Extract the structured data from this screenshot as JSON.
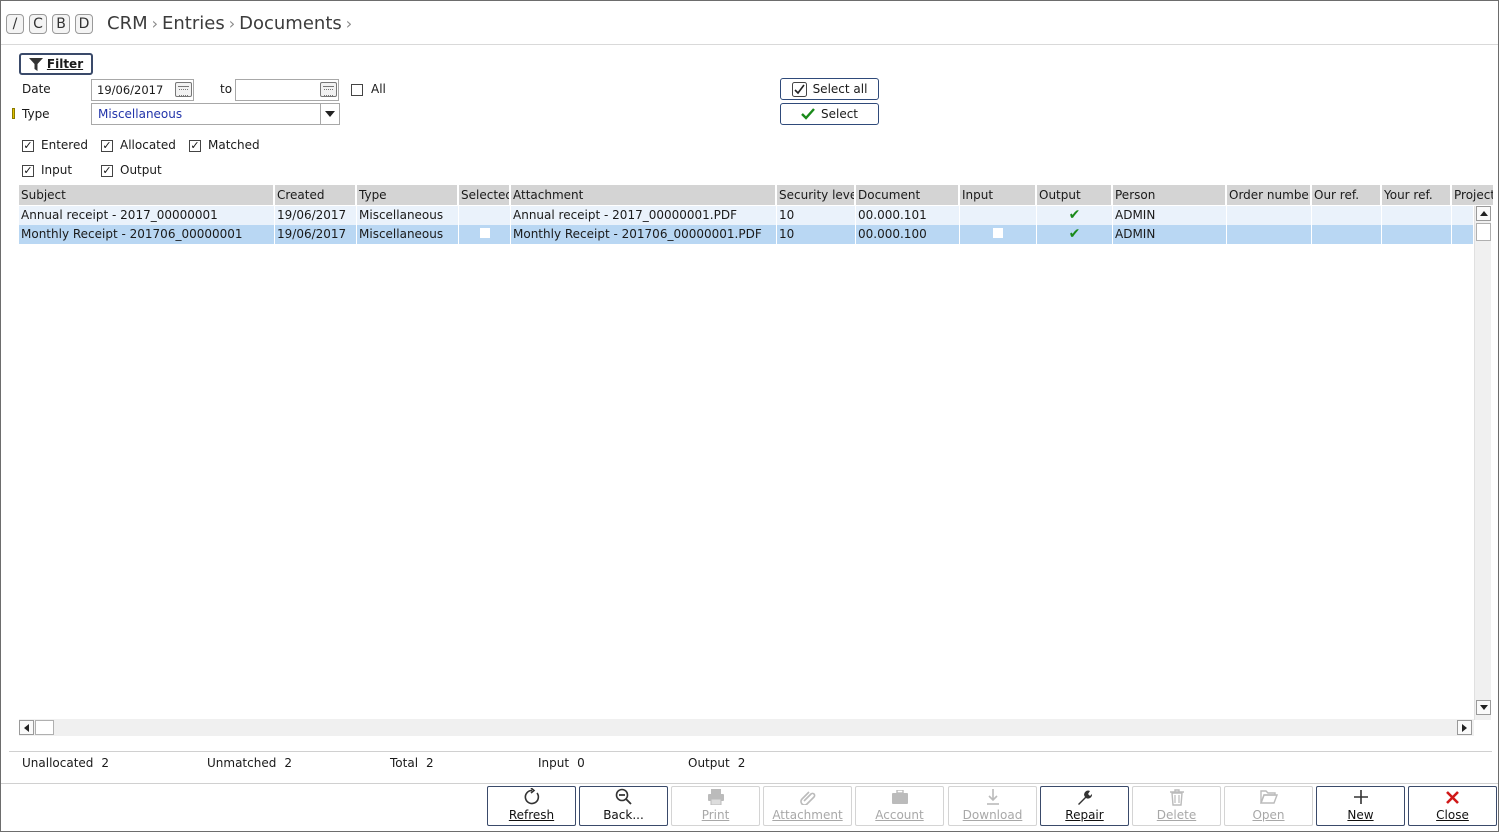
{
  "shortcuts": [
    "/",
    "C",
    "B",
    "D"
  ],
  "breadcrumb": [
    "CRM",
    "Entries",
    "Documents"
  ],
  "filter": {
    "button_label": "Filter",
    "date_label": "Date",
    "date_from": "19/06/2017",
    "to_label": "to",
    "date_to": "",
    "all_label": "All",
    "all_checked": false,
    "type_label": "Type",
    "type_value": "Miscellaneous",
    "checks": [
      {
        "label": "Entered",
        "checked": true
      },
      {
        "label": "Allocated",
        "checked": true
      },
      {
        "label": "Matched",
        "checked": true
      },
      {
        "label": "Input",
        "checked": true
      },
      {
        "label": "Output",
        "checked": true
      }
    ],
    "select_all_label": "Select all",
    "select_label": "Select"
  },
  "grid": {
    "columns": [
      "Subject",
      "Created",
      "Type",
      "Selected",
      "Attachment",
      "Security level",
      "Document",
      "Input",
      "Output",
      "Person",
      "Order number",
      "Our ref.",
      "Your ref.",
      "Project"
    ],
    "rows": [
      {
        "subject": "Annual receipt - 2017_00000001",
        "created": "19/06/2017",
        "type": "Miscellaneous",
        "selected": false,
        "attachment": "Annual receipt - 2017_00000001.PDF",
        "security": "10",
        "document": "00.000.101",
        "input": false,
        "output": true,
        "person": "ADMIN"
      },
      {
        "subject": "Monthly Receipt - 201706_00000001",
        "created": "19/06/2017",
        "type": "Miscellaneous",
        "selected": false,
        "attachment": "Monthly Receipt - 201706_00000001.PDF",
        "security": "10",
        "document": "00.000.100",
        "input": false,
        "output": true,
        "person": "ADMIN"
      }
    ]
  },
  "status": {
    "unallocated_label": "Unallocated",
    "unallocated": "2",
    "unmatched_label": "Unmatched",
    "unmatched": "2",
    "total_label": "Total",
    "total": "2",
    "input_label": "Input",
    "input": "0",
    "output_label": "Output",
    "output": "2"
  },
  "toolbar": [
    {
      "label": "Refresh",
      "icon": "refresh-icon",
      "enabled": true
    },
    {
      "label": "Back...",
      "icon": "zoom-out-icon",
      "enabled": true
    },
    {
      "label": "Print",
      "icon": "printer-icon",
      "enabled": false
    },
    {
      "label": "Attachment",
      "icon": "paperclip-icon",
      "enabled": false
    },
    {
      "label": "Account",
      "icon": "briefcase-icon",
      "enabled": false
    },
    {
      "label": "Download",
      "icon": "download-icon",
      "enabled": false
    },
    {
      "label": "Repair",
      "icon": "wrench-icon",
      "enabled": true
    },
    {
      "label": "Delete",
      "icon": "trash-icon",
      "enabled": false
    },
    {
      "label": "Open",
      "icon": "folder-open-icon",
      "enabled": false
    },
    {
      "label": "New",
      "icon": "plus-icon",
      "enabled": true
    },
    {
      "label": "Close",
      "icon": "close-icon",
      "enabled": true
    }
  ],
  "colors": {
    "selected_row": "#b9d7f3",
    "check_green": "#1a8a1a",
    "close_red": "#d01818",
    "link_blue": "#2234aa"
  }
}
